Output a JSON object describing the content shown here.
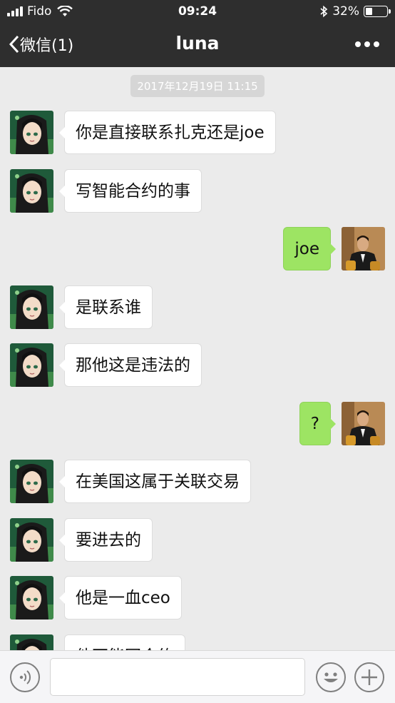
{
  "status_bar": {
    "carrier": "Fido",
    "time": "09:24",
    "battery_percent": "32%",
    "battery_level": 0.32
  },
  "nav": {
    "back_label": "微信(1)",
    "title": "luna",
    "more_icon": "more-dots-icon"
  },
  "chat": {
    "timestamp": "2017年12月19日 11:15",
    "messages": [
      {
        "side": "in",
        "text": "你是直接联系扎克还是joe"
      },
      {
        "side": "in",
        "text": "写智能合约的事"
      },
      {
        "side": "out",
        "text": "joe"
      },
      {
        "side": "in",
        "text": "是联系谁"
      },
      {
        "side": "in",
        "text": "那他这是违法的"
      },
      {
        "side": "out",
        "text": "?"
      },
      {
        "side": "in",
        "text": "在美国这属于关联交易"
      },
      {
        "side": "in",
        "text": "要进去的"
      },
      {
        "side": "in",
        "text": "他是一血ceo"
      },
      {
        "side": "in",
        "text": "他不能写合约"
      }
    ]
  },
  "input_bar": {
    "input_value": "",
    "icons": [
      "voice-icon",
      "emoji-icon",
      "plus-icon"
    ]
  },
  "colors": {
    "header_bg": "#2e2e2e",
    "chat_bg": "#ebebeb",
    "outgoing_bubble": "#9de463",
    "incoming_bubble": "#ffffff"
  }
}
